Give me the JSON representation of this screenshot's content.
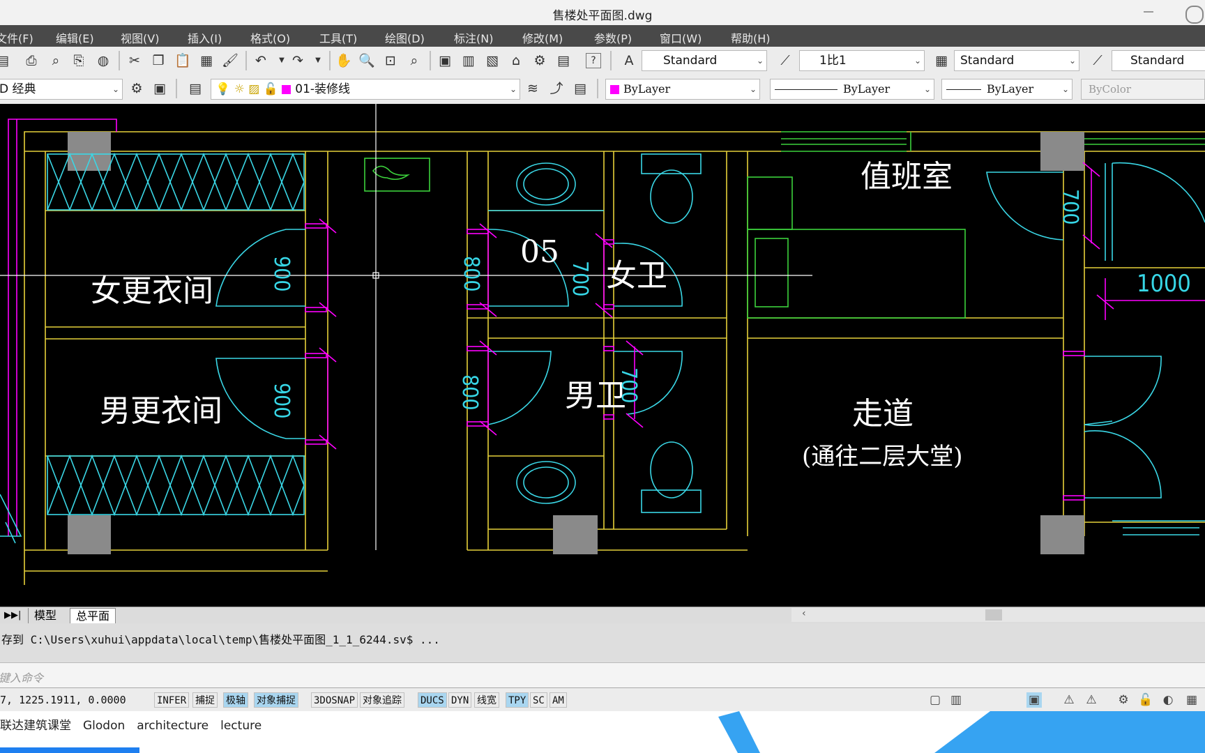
{
  "window": {
    "title": "售楼处平面图.dwg"
  },
  "menu": [
    "文件(F)",
    "编辑(E)",
    "视图(V)",
    "插入(I)",
    "格式(O)",
    "工具(T)",
    "绘图(D)",
    "标注(N)",
    "修改(M)",
    "参数(P)",
    "窗口(W)",
    "帮助(H)"
  ],
  "toolbar1": {
    "text_style": "Standard",
    "annotation_scale": "1比1",
    "table_style": "Standard",
    "multileader_style": "Standard"
  },
  "toolbar2": {
    "workspace": "D 经典",
    "layer": "01-装修线",
    "layer_color": "#ff00ff",
    "color": "ByLayer",
    "linetype": "ByLayer",
    "lineweight": "ByLayer",
    "plotstyle": "ByColor"
  },
  "drawing": {
    "rooms": {
      "female_locker": "女更衣间",
      "male_locker": "男更衣间",
      "duty_room": "值班室",
      "female_wc": "女卫",
      "male_wc": "男卫",
      "corridor": "走道",
      "corridor_note": "(通往二层大堂)",
      "label_05": "05"
    },
    "dims": {
      "d900a": "900",
      "d900b": "900",
      "d800a": "800",
      "d800b": "800",
      "d700a": "700",
      "d700b": "700",
      "d700c": "700",
      "d1000": "1000"
    },
    "colors": {
      "wall": "#e6d13a",
      "fixture": "#3ad7e6",
      "dimension": "#ff00ff",
      "green": "#3cd23c",
      "column": "#8a8a8a"
    }
  },
  "tabs": {
    "model": "模型",
    "layout": "总平面"
  },
  "command": {
    "history": "存到 C:\\Users\\xuhui\\appdata\\local\\temp\\售楼处平面图_1_1_6244.sv$ ...",
    "placeholder": "键入命令"
  },
  "status": {
    "coords": "7, 1225.1911, 0.0000",
    "buttons": [
      {
        "label": "INFER",
        "on": false
      },
      {
        "label": "捕捉",
        "on": false
      },
      {
        "label": "极轴",
        "on": true
      },
      {
        "label": "对象捕捉",
        "on": true
      },
      {
        "label": "3DOSNAP",
        "on": false
      },
      {
        "label": "对象追踪",
        "on": false
      },
      {
        "label": "DUCS",
        "on": true
      },
      {
        "label": "DYN",
        "on": false
      },
      {
        "label": "线宽",
        "on": false
      },
      {
        "label": "TPY",
        "on": true
      },
      {
        "label": "SC",
        "on": false
      },
      {
        "label": "AM",
        "on": false
      }
    ]
  },
  "watermark": {
    "text": "联达建筑课堂　Glodon　architecture　lecture"
  }
}
